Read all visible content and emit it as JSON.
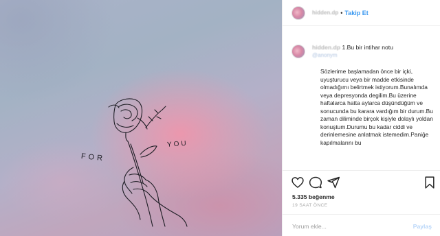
{
  "header": {
    "username": "hidden.dp",
    "separator": "•",
    "follow_label": "Takip Et"
  },
  "caption": {
    "username": "hidden.dp",
    "title": "1.Bu bir intihar notu",
    "tag": "@anonym",
    "body": "Sözlerime başlamadan önce bir içki, uyuşturucu veya bir madde etkisinde olmadığımı belirtmek istiyorum.Bunalımda veya depresyonda degilim.Bu üzerine haftalarca hatta aylarca düşündüğüm ve sonucunda bu karara vardığım bir durum.Bu zaman diliminde birçok kişiyle dolaylı yoldan konuştum.Durumu bu kadar ciddi ve derinlemesine anlatmak istemedim.Paniğe kapılmalarını bu"
  },
  "image": {
    "text_left": "FOR",
    "text_right": "YOU"
  },
  "likes": "5.335 beğenme",
  "timestamp": "19 SAAT ÖNCE",
  "comment": {
    "placeholder": "Yorum ekle...",
    "post_label": "Paylaş"
  },
  "icons": [
    "heart-icon",
    "comment-icon",
    "share-icon",
    "bookmark-icon"
  ],
  "colors": {
    "accent": "#3897f0",
    "post_disabled": "#b8d6f9",
    "text": "#262626",
    "muted": "#a8a8a8"
  }
}
